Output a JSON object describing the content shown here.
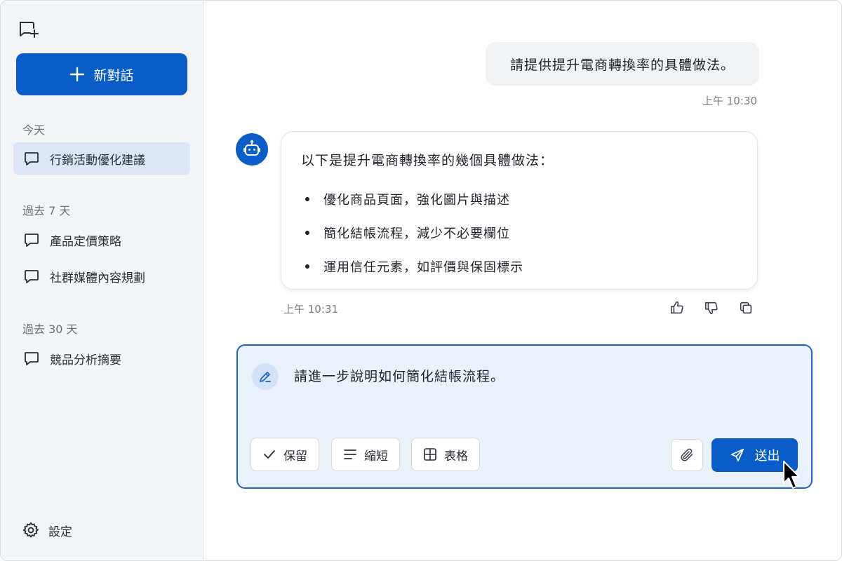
{
  "sidebar": {
    "new_chat_label": "新對話",
    "sections": [
      {
        "label": "今天",
        "items": [
          {
            "label": "行銷活動優化建議",
            "active": true
          }
        ]
      },
      {
        "label": "過去 7 天",
        "items": [
          {
            "label": "產品定價策略"
          },
          {
            "label": "社群媒體內容規劃"
          }
        ]
      },
      {
        "label": "過去 30 天",
        "items": [
          {
            "label": "競品分析摘要"
          }
        ]
      }
    ],
    "settings_label": "設定"
  },
  "chat": {
    "user_message": "請提供提升電商轉換率的具體做法。",
    "user_time": "上午 10:30",
    "bot_intro": "以下是提升電商轉換率的幾個具體做法：",
    "bot_points": [
      "優化商品頁面，強化圖片與描述",
      "簡化結帳流程，減少不必要欄位",
      "運用信任元素，如評價與保固標示"
    ],
    "bot_time": "上午 10:31"
  },
  "composer": {
    "value": "請進一步說明如何簡化結帳流程。",
    "chips": [
      {
        "label": "保留",
        "icon": "check-icon"
      },
      {
        "label": "縮短",
        "icon": "lines-icon"
      },
      {
        "label": "表格",
        "icon": "table-icon"
      }
    ],
    "send_label": "送出"
  },
  "colors": {
    "accent": "#0a5dc8",
    "sidebar_bg": "#f3f4f6",
    "active_item_bg": "#dbe6f6",
    "composer_bg": "#eaf1fb"
  }
}
